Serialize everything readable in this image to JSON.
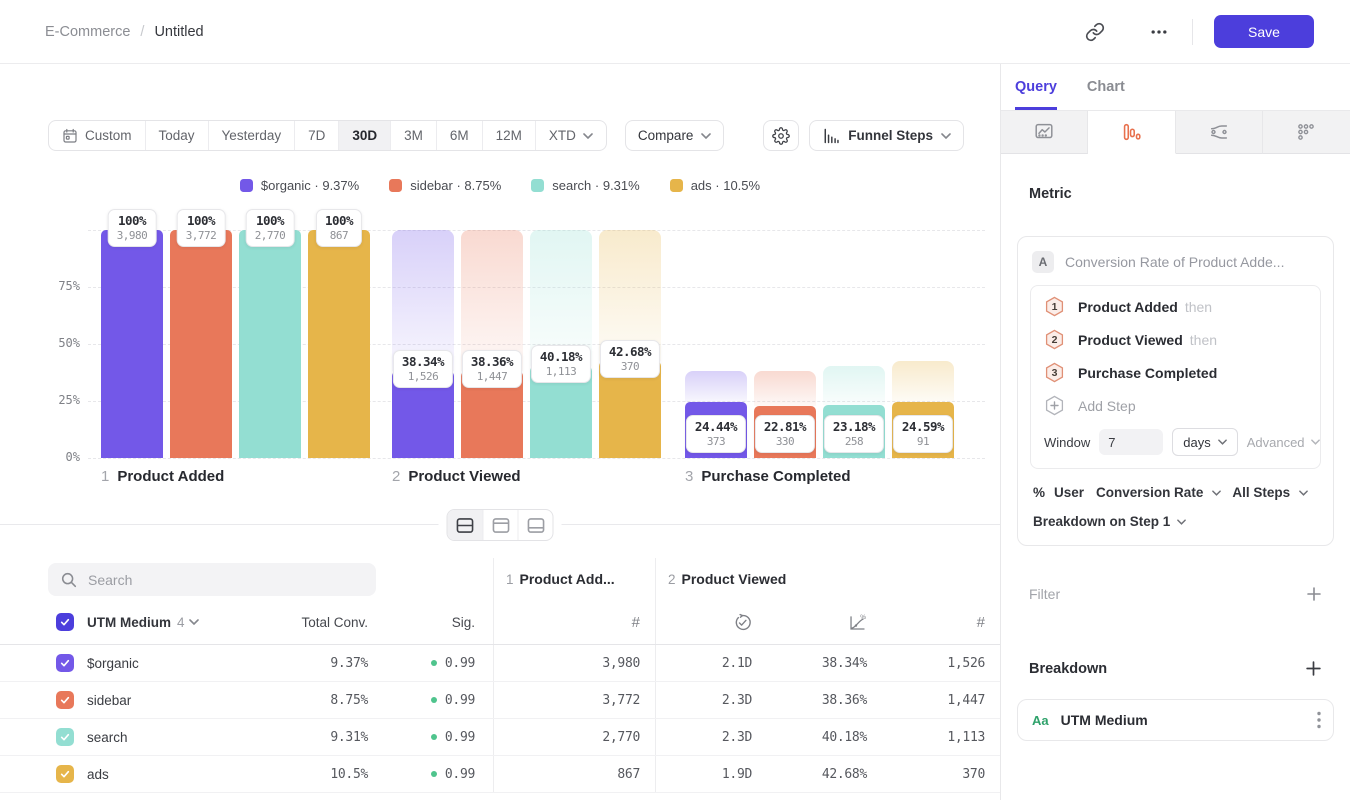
{
  "colors": {
    "accent": "#4C3EDC",
    "sig_green": "#4FC48D",
    "funnel_tab_orange": "#E8704D",
    "aa_green": "#2FA26B"
  },
  "topbar": {
    "breadcrumb": {
      "root": "E-Commerce",
      "separator": "/",
      "current": "Untitled"
    },
    "save_label": "Save"
  },
  "toolbar": {
    "ranges": [
      {
        "label": "Custom",
        "icon": "calendar"
      },
      {
        "label": "Today"
      },
      {
        "label": "Yesterday"
      },
      {
        "label": "7D"
      },
      {
        "label": "30D",
        "selected": true
      },
      {
        "label": "3M"
      },
      {
        "label": "6M"
      },
      {
        "label": "12M"
      },
      {
        "label": "XTD",
        "chevron": true
      }
    ],
    "compare_label": "Compare",
    "view_label": "Funnel Steps"
  },
  "chart_data": {
    "type": "bar",
    "subtype": "funnel-steps",
    "categories": [
      "Product Added",
      "Product Viewed",
      "Purchase Completed"
    ],
    "category_numbers": [
      "1",
      "2",
      "3"
    ],
    "yticks": [
      "0%",
      "25%",
      "50%",
      "75%"
    ],
    "ylim": [
      0,
      100
    ],
    "grid": "dashed-horizontal",
    "legend_position": "top-center",
    "series": [
      {
        "name": "$organic",
        "overall": "9.37%",
        "color": "#7358E8",
        "pct": [
          100,
          38.34,
          24.44
        ],
        "counts": [
          "3,980",
          "1,526",
          "373"
        ]
      },
      {
        "name": "sidebar",
        "overall": "8.75%",
        "color": "#E8785A",
        "pct": [
          100,
          38.36,
          22.81
        ],
        "counts": [
          "3,772",
          "1,447",
          "330"
        ]
      },
      {
        "name": "search",
        "overall": "9.31%",
        "color": "#93DED2",
        "pct": [
          100,
          40.18,
          23.18
        ],
        "counts": [
          "2,770",
          "1,113",
          "258"
        ]
      },
      {
        "name": "ads",
        "overall": "10.5%",
        "color": "#E6B54A",
        "pct": [
          100,
          42.68,
          24.59
        ],
        "counts": [
          "867",
          "370",
          "91"
        ]
      }
    ]
  },
  "table": {
    "search_placeholder": "Search",
    "count_symbol": "#",
    "breakdown_col": {
      "label": "UTM Medium",
      "count": "4"
    },
    "columns": {
      "total": "Total Conv.",
      "sig": "Sig."
    },
    "groups": [
      {
        "num": "1",
        "label": "Product Add..."
      },
      {
        "num": "2",
        "label": "Product Viewed"
      }
    ],
    "rows": [
      {
        "name": "$organic",
        "color": "#7358E8",
        "total": "9.37%",
        "sig": "0.99",
        "s1_count": "3,980",
        "s2_time": "2.1D",
        "s2_conv": "38.34%",
        "s2_count": "1,526"
      },
      {
        "name": "sidebar",
        "color": "#E8785A",
        "total": "8.75%",
        "sig": "0.99",
        "s1_count": "3,772",
        "s2_time": "2.3D",
        "s2_conv": "38.36%",
        "s2_count": "1,447"
      },
      {
        "name": "search",
        "color": "#93DED2",
        "total": "9.31%",
        "sig": "0.99",
        "s1_count": "2,770",
        "s2_time": "2.3D",
        "s2_conv": "40.18%",
        "s2_count": "1,113"
      },
      {
        "name": "ads",
        "color": "#E6B54A",
        "total": "10.5%",
        "sig": "0.99",
        "s1_count": "867",
        "s2_time": "1.9D",
        "s2_conv": "42.68%",
        "s2_count": "370"
      }
    ]
  },
  "query_panel": {
    "tabs": [
      {
        "label": "Query",
        "active": true
      },
      {
        "label": "Chart",
        "active": false
      }
    ],
    "active_chart_type": "funnel",
    "metric": {
      "heading": "Metric",
      "badge": "A",
      "title": "Conversion Rate of Product Adde...",
      "steps": [
        {
          "num": "1",
          "label": "Product Added",
          "suffix": "then"
        },
        {
          "num": "2",
          "label": "Product Viewed",
          "suffix": "then"
        },
        {
          "num": "3",
          "label": "Purchase Completed",
          "suffix": ""
        }
      ],
      "add_step_label": "Add Step",
      "window_label": "Window",
      "window_value": "7",
      "window_unit": "days",
      "advanced_label": "Advanced",
      "measure": {
        "prefix": "%",
        "entity": "User",
        "metric": "Conversion Rate",
        "scope": "All Steps"
      },
      "breakdown_on": "Breakdown on Step 1"
    },
    "filter": {
      "heading": "Filter"
    },
    "breakdown": {
      "heading": "Breakdown",
      "item": {
        "badge": "Aa",
        "label": "UTM Medium"
      }
    }
  }
}
